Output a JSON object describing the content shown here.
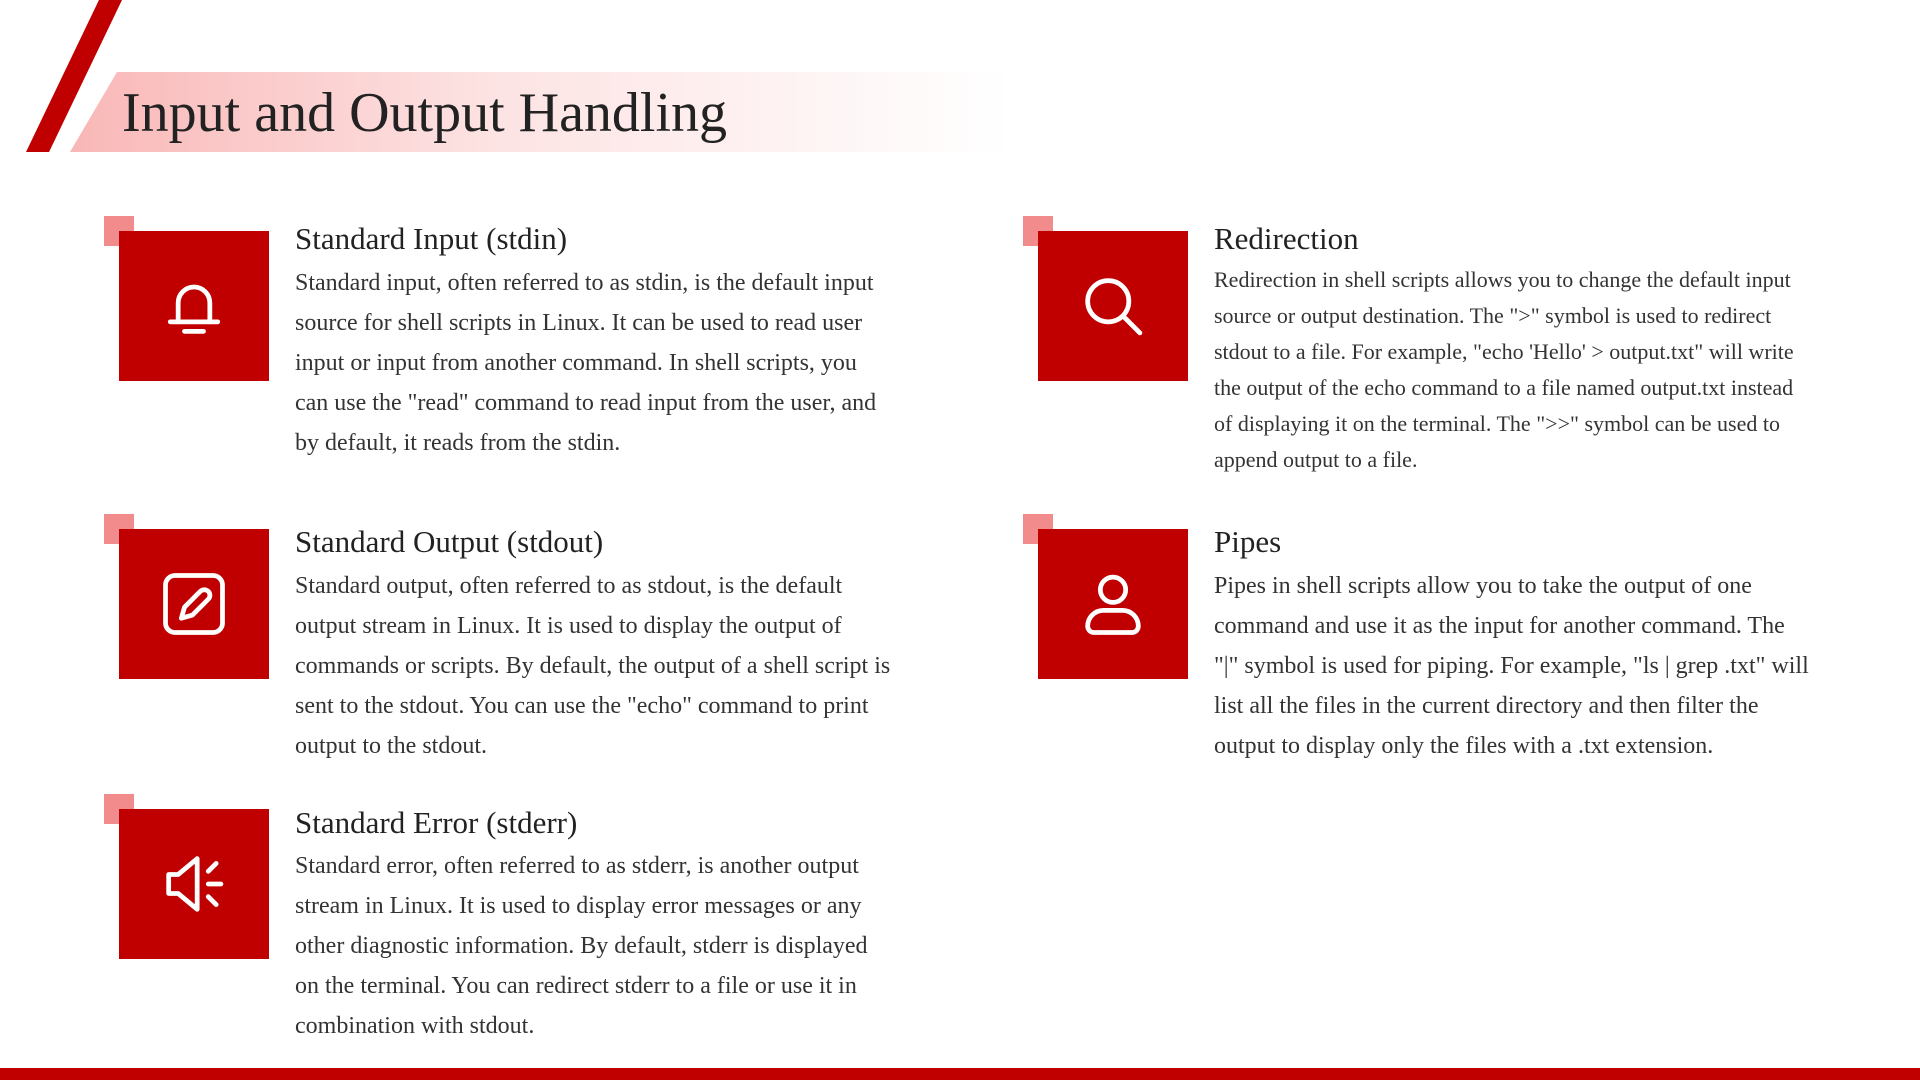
{
  "slide": {
    "title": "Input and Output Handling"
  },
  "items": [
    {
      "icon": "bell-icon",
      "title": "Standard Input (stdin)",
      "text": "Standard input, often referred to as stdin, is the default input source for shell scripts in Linux. It can be used to read user input or input from another command. In shell scripts, you can use the \"read\" command to read input from the user, and by default, it reads from the stdin."
    },
    {
      "icon": "edit-icon",
      "title": "Standard Output (stdout)",
      "text": "Standard output, often referred to as stdout, is the default output stream in Linux. It is used to display the output of commands or scripts. By default, the output of a shell script is sent to the stdout. You can use the \"echo\" command to print output to the stdout."
    },
    {
      "icon": "speaker-icon",
      "title": "Standard Error (stderr)",
      "text": "Standard error, often referred to as stderr, is another output stream in Linux. It is used to display error messages or any other diagnostic information. By default, stderr is displayed on the terminal. You can redirect stderr to a file or use it in combination with stdout."
    },
    {
      "icon": "search-icon",
      "title": "Redirection",
      "text": "Redirection in shell scripts allows you to change the default input source or output destination. The \">\" symbol is used to redirect stdout to a file. For example, \"echo 'Hello' > output.txt\" will write the output of the echo command to a file named output.txt instead of displaying it on the terminal. The \">>\" symbol can be used to append output to a file."
    },
    {
      "icon": "user-icon",
      "title": "Pipes",
      "text": "Pipes in shell scripts allow you to take the output of one command and use it as the input for another command. The \"|\" symbol is used for piping. For example, \"ls | grep .txt\" will list all the files in the current directory and then filter the output to display only the files with a .txt extension."
    }
  ],
  "colors": {
    "accent_red": "#c00000",
    "accent_pink": "#f28b8b",
    "title_band_start": "#f9b7b7"
  }
}
